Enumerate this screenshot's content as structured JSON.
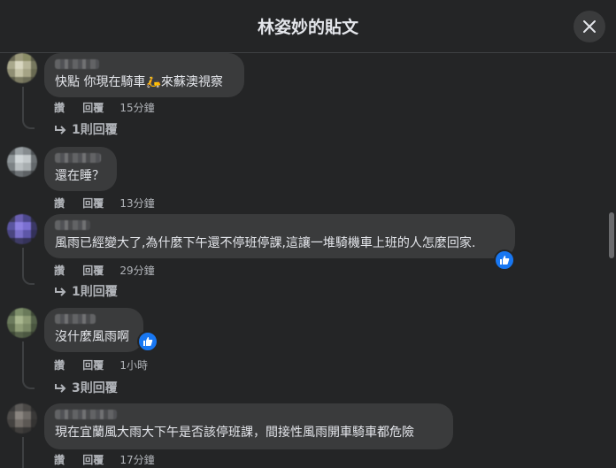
{
  "header": {
    "title": "林姿妙的貼文",
    "close_icon": "close-icon"
  },
  "comments": [
    {
      "text": "快點 你現在騎車🛵來蘇澳視察",
      "like": "讚",
      "reply": "回覆",
      "time": "15分鐘",
      "replies": "1則回覆",
      "reaction": false
    },
    {
      "text": "還在睡？",
      "like": "讚",
      "reply": "回覆",
      "time": "13分鐘",
      "replies": "",
      "reaction": false
    },
    {
      "text": "風雨已經變大了,為什麼下午還不停班停課,這讓一堆騎機車上班的人怎麼回家.",
      "like": "讚",
      "reply": "回覆",
      "time": "29分鐘",
      "replies": "1則回覆",
      "reaction": true
    },
    {
      "text": "沒什麼風雨啊",
      "like": "讚",
      "reply": "回覆",
      "time": "1小時",
      "replies": "3則回覆",
      "reaction": true
    },
    {
      "text": "現在宜蘭風大雨大下午是否該停班課，間接性風雨開車騎車都危險",
      "like": "讚",
      "reply": "回覆",
      "time": "17分鐘",
      "replies": "",
      "reaction": false
    }
  ],
  "colors": {
    "background": "#242526",
    "bubble": "#3a3b3c",
    "text": "#e4e6eb",
    "secondary": "#b0b3b8",
    "like_blue": "#1877f2"
  }
}
